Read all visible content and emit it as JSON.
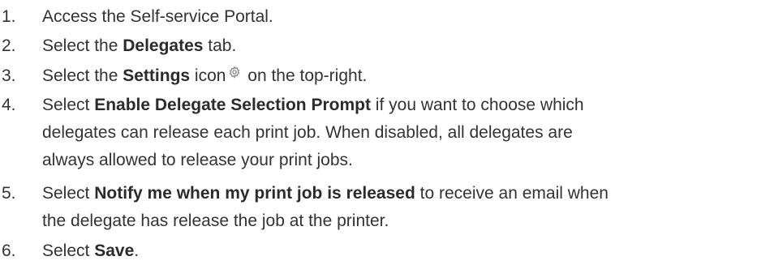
{
  "steps": [
    {
      "number": "1.",
      "pre": "Access the Self-service Portal.",
      "bold": "",
      "post": ""
    },
    {
      "number": "2.",
      "pre": "Select the ",
      "bold": "Delegates",
      "post": " tab."
    },
    {
      "number": "3.",
      "pre": "Select the ",
      "bold": "Settings",
      "post": " icon",
      "icon": "gear-icon",
      "post2": " on the top-right."
    },
    {
      "number": "4.",
      "pre": "Select ",
      "bold": "Enable Delegate Selection Prompt",
      "post": " if you want to choose which",
      "line2": "delegates can release each print job. When disabled, all delegates are",
      "line3": "always allowed to release your print jobs."
    },
    {
      "number": "5.",
      "pre": "Select ",
      "bold": "Notify me when my print job is released",
      "post": " to receive an email when",
      "line2": "the delegate has release the job at the printer."
    },
    {
      "number": "6.",
      "pre": "Select ",
      "bold": "Save",
      "post": "."
    }
  ],
  "colors": {
    "text": "#333333",
    "icon": "#8a8a8a"
  }
}
